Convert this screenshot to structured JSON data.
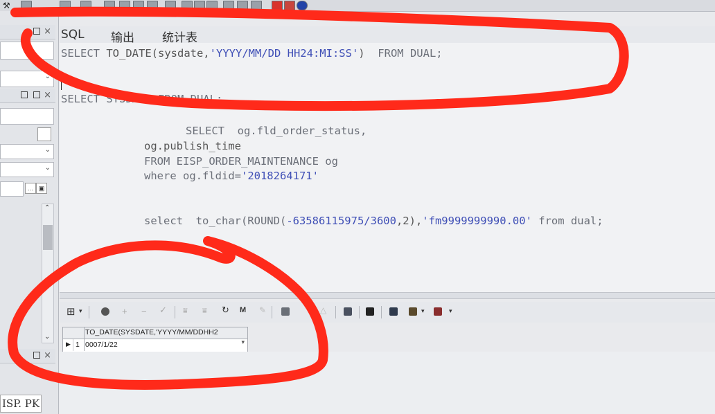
{
  "window": {
    "tabs": [
      "SQL",
      "输出",
      "统计表"
    ]
  },
  "left_panel": {
    "bottom_label": "ISP. PK"
  },
  "editor": {
    "lines": [
      {
        "kw1": "SELECT ",
        "fn": "TO_DATE",
        "p1": "(sysdate,",
        "str": "'YYYY/MM/DD HH24:MI:SS'",
        "p2": ")  ",
        "kw2": "FROM DUAL;"
      },
      {
        "text": "SELECT SYSDATE FROM DUAL;"
      },
      {
        "text": "SELECT  og.fld_order_status,"
      },
      {
        "text": "og.publish_time"
      },
      {
        "text": "FROM EISP_ORDER_MAINTENANCE og"
      },
      {
        "kw": "where og.fldid=",
        "str": "'2018264171'"
      },
      {
        "kw": "select  to_char(ROUND(",
        "num": "-63586115975/3600",
        "mid": ",2),",
        "str": "'fm9999999990.00'",
        "tail": " from dual;"
      }
    ]
  },
  "result_grid": {
    "column_header": "TO_DATE(SYSDATE,'YYYY/MM/DDHH2",
    "rows": [
      {
        "num": "1",
        "value": "0007/1/22"
      }
    ]
  },
  "colors": {
    "annotation_red": "#ff2a1a",
    "string_literal": "#3f4fb6",
    "keyword": "#6b6f78"
  },
  "icons": [
    "wrench-icon",
    "grid-icon",
    "lock-icon",
    "plus-icon",
    "minus-icon",
    "check-icon",
    "filter-icon",
    "refresh-icon",
    "binoculars-icon",
    "pencil-icon",
    "house-icon",
    "triangle-icon",
    "chart-icon",
    "save-icon",
    "database-icon",
    "export-icon",
    "film-icon"
  ]
}
